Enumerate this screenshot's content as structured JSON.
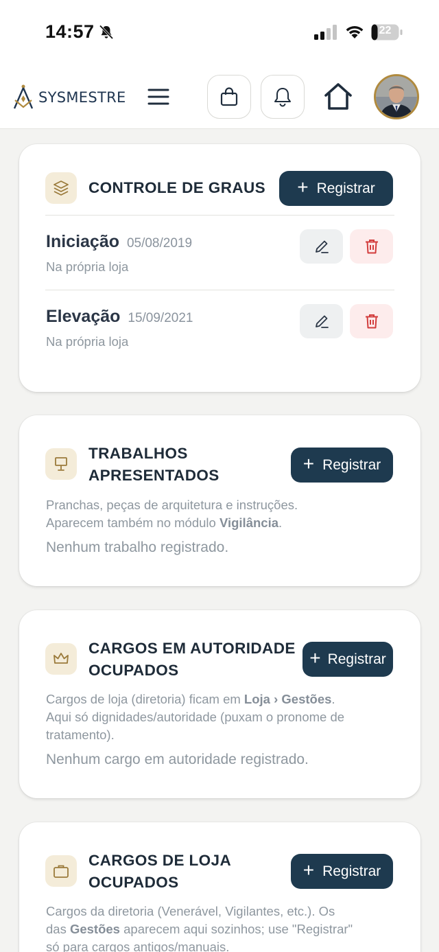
{
  "status_bar": {
    "time": "14:57",
    "battery": "22"
  },
  "header": {
    "logo_text_a": "SYS",
    "logo_text_b": "MESTRE",
    "icons": [
      "menu-icon",
      "shopping-bag-icon",
      "bell-icon",
      "home-icon"
    ]
  },
  "colors": {
    "primary": "#1e3a4f",
    "gold": "#b08a3e",
    "icon_bg": "#f4ecd9",
    "danger": "#d23c3c",
    "background": "#f3f3f1"
  },
  "grades": {
    "title": "CONTROLE DE GRAUS",
    "register_label": "Registrar",
    "items": [
      {
        "name": "Iniciação",
        "date": "05/08/2019",
        "place": "Na própria loja"
      },
      {
        "name": "Elevação",
        "date": "15/09/2021",
        "place": "Na própria loja"
      }
    ]
  },
  "works": {
    "title_line1": "TRABALHOS",
    "title_line2": "APRESENTADOS",
    "register_label": "Registrar",
    "desc_line1": "Pranchas, peças de arquitetura e instruções.",
    "desc_line2_a": "Aparecem também no módulo ",
    "desc_line2_b": "Vigilância",
    "desc_line2_c": ".",
    "empty": "Nenhum trabalho registrado."
  },
  "authority": {
    "title_line1": "CARGOS EM AUTORIDADE",
    "title_line2": "OCUPADOS",
    "register_label": "Registrar",
    "desc_a": "Cargos de loja (diretoria) ficam em ",
    "desc_b": "Loja › Gestões",
    "desc_c": ".",
    "desc_line2": "Aqui só dignidades/autoridade (puxam o pronome de",
    "desc_line3": "tratamento).",
    "empty": "Nenhum cargo em autoridade registrado."
  },
  "lodge": {
    "title_line1": "CARGOS DE LOJA",
    "title_line2": "OCUPADOS",
    "register_label": "Registrar",
    "desc_line1": "Cargos da diretoria (Venerável, Vigilantes, etc.). Os",
    "desc_line2_a": "das ",
    "desc_line2_b": "Gestões",
    "desc_line2_c": " aparecem aqui sozinhos; use \"Registrar\"",
    "desc_line3": "só para cargos antigos/manuais."
  }
}
